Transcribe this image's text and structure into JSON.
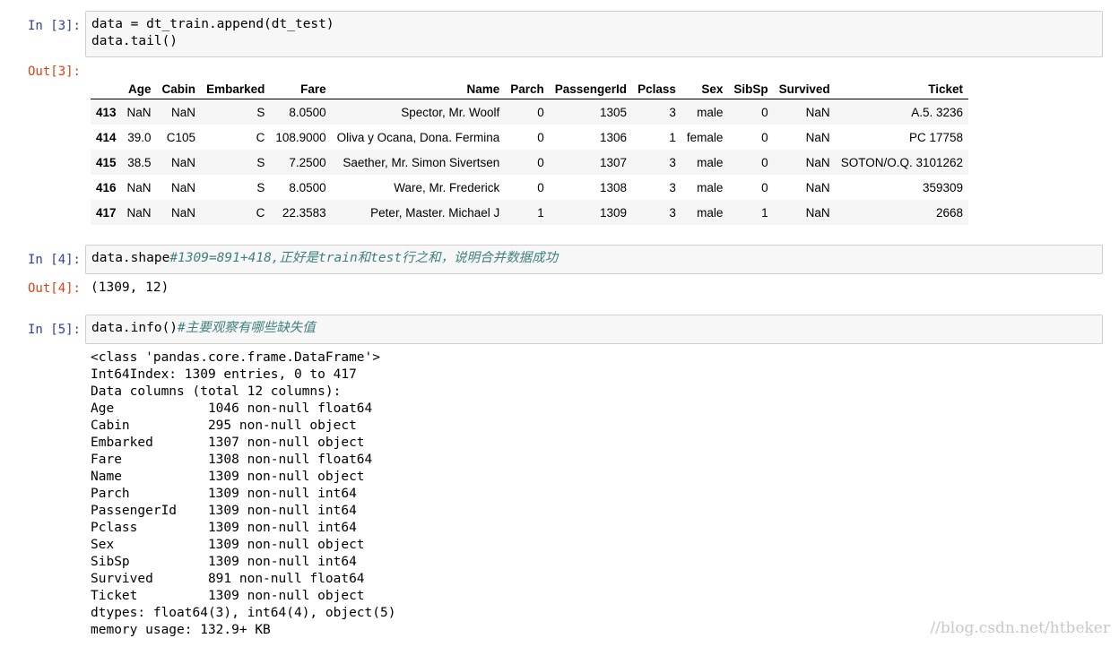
{
  "cells": {
    "in3": {
      "prompt": "In [3]:",
      "code_line1": "data = dt_train.append(dt_test)",
      "code_line2": "data.tail()"
    },
    "out3": {
      "prompt": "Out[3]:",
      "table": {
        "columns": [
          "",
          "Age",
          "Cabin",
          "Embarked",
          "Fare",
          "Name",
          "Parch",
          "PassengerId",
          "Pclass",
          "Sex",
          "SibSp",
          "Survived",
          "Ticket"
        ],
        "rows": [
          [
            "413",
            "NaN",
            "NaN",
            "S",
            "8.0500",
            "Spector, Mr. Woolf",
            "0",
            "1305",
            "3",
            "male",
            "0",
            "NaN",
            "A.5. 3236"
          ],
          [
            "414",
            "39.0",
            "C105",
            "C",
            "108.9000",
            "Oliva y Ocana, Dona. Fermina",
            "0",
            "1306",
            "1",
            "female",
            "0",
            "NaN",
            "PC 17758"
          ],
          [
            "415",
            "38.5",
            "NaN",
            "S",
            "7.2500",
            "Saether, Mr. Simon Sivertsen",
            "0",
            "1307",
            "3",
            "male",
            "0",
            "NaN",
            "SOTON/O.Q. 3101262"
          ],
          [
            "416",
            "NaN",
            "NaN",
            "S",
            "8.0500",
            "Ware, Mr. Frederick",
            "0",
            "1308",
            "3",
            "male",
            "0",
            "NaN",
            "359309"
          ],
          [
            "417",
            "NaN",
            "NaN",
            "C",
            "22.3583",
            "Peter, Master. Michael J",
            "1",
            "1309",
            "3",
            "male",
            "1",
            "NaN",
            "2668"
          ]
        ]
      }
    },
    "in4": {
      "prompt": "In [4]:",
      "code": "data.shape",
      "comment": "#1309=891+418,正好是train和test行之和，说明合并数据成功"
    },
    "out4": {
      "prompt": "Out[4]:",
      "text": "(1309, 12)"
    },
    "in5": {
      "prompt": "In [5]:",
      "code": "data.info()",
      "comment": "#主要观察有哪些缺失值"
    },
    "out5": {
      "lines": [
        "<class 'pandas.core.frame.DataFrame'>",
        "Int64Index: 1309 entries, 0 to 417",
        "Data columns (total 12 columns):",
        "Age            1046 non-null float64",
        "Cabin          295 non-null object",
        "Embarked       1307 non-null object",
        "Fare           1308 non-null float64",
        "Name           1309 non-null object",
        "Parch          1309 non-null int64",
        "PassengerId    1309 non-null int64",
        "Pclass         1309 non-null int64",
        "Sex            1309 non-null object",
        "SibSp          1309 non-null int64",
        "Survived       891 non-null float64",
        "Ticket         1309 non-null object",
        "dtypes: float64(3), int64(4), object(5)",
        "memory usage: 132.9+ KB"
      ]
    }
  },
  "watermark": "//blog.csdn.net/htbeker",
  "colors": {
    "in_prompt": "#303f9f",
    "out_prompt": "#d84315",
    "comment": "#408080",
    "input_bg": "#f7f7f7"
  }
}
